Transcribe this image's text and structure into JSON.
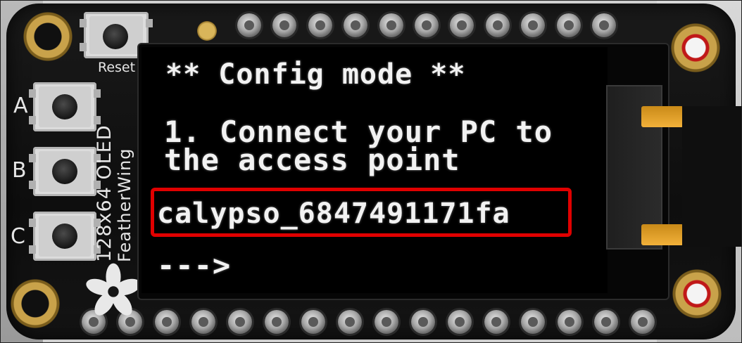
{
  "board": {
    "silkscreen": {
      "reset": "Reset",
      "button_a": "A",
      "button_b": "B",
      "button_c": "C",
      "model_line1": "128x64 OLED",
      "model_line2": "FeatherWing"
    }
  },
  "oled": {
    "title": "** Config mode **",
    "instruction_line1": "1. Connect your PC to",
    "instruction_line2": "the access point",
    "ssid": "calypso_6847491171fa",
    "arrow": "--->"
  },
  "highlight": {
    "color": "#e00000",
    "target": "ssid"
  },
  "icons": [
    "adafruit-flower-icon",
    "push-button-icon",
    "header-pin-icon",
    "mounting-hole-icon"
  ]
}
